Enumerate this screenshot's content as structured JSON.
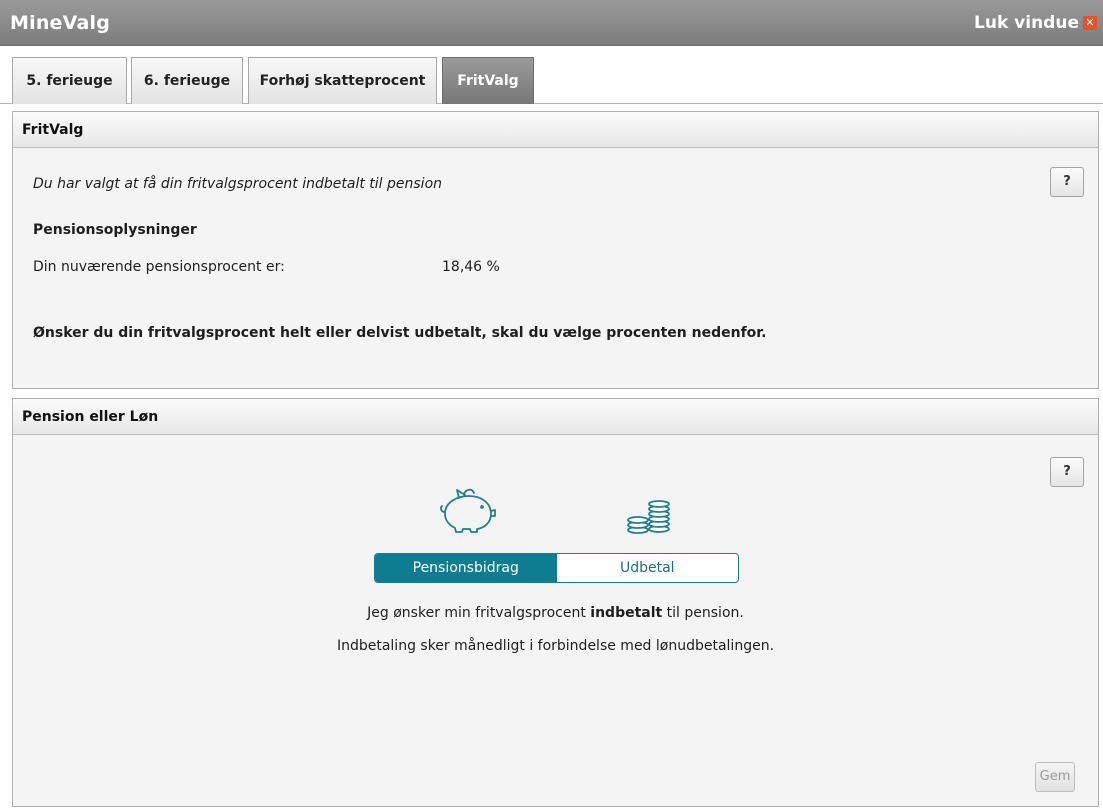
{
  "window": {
    "title": "MineValg",
    "close_label": "Luk vindue",
    "close_glyph": "✕"
  },
  "tabs": [
    {
      "label": "5. ferieuge",
      "active": false
    },
    {
      "label": "6. ferieuge",
      "active": false
    },
    {
      "label": "Forhøj skatteprocent",
      "active": false
    },
    {
      "label": "FritValg",
      "active": true
    }
  ],
  "fritvalg_panel": {
    "header": "FritValg",
    "help_label": "?",
    "intro": "Du har valgt at få din fritvalgsprocent indbetalt til pension",
    "section_title": "Pensionsoplysninger",
    "rate_label": "Din nuværende pensionsprocent er:",
    "rate_value": "18,46 %",
    "notice": "Ønsker du din fritvalgsprocent helt eller delvist udbetalt, skal du vælge procenten nedenfor."
  },
  "pension_panel": {
    "header": "Pension eller Løn",
    "help_label": "?",
    "icons": [
      "piggy-bank-icon",
      "coin-stack-icon"
    ],
    "toggle": {
      "options": [
        "Pensionsbidrag",
        "Udbetal"
      ],
      "selected": "Pensionsbidrag"
    },
    "line1_pre": "Jeg ønsker min fritvalgsprocent ",
    "line1_bold": "indbetalt",
    "line1_post": " til pension.",
    "line2": "Indbetaling sker månedligt i forbindelse med lønudbetalingen.",
    "save_label": "Gem"
  },
  "colors": {
    "accent": "#0f7d91",
    "titlebar": "#8a8a8a",
    "close_icon": "#e8502a"
  }
}
